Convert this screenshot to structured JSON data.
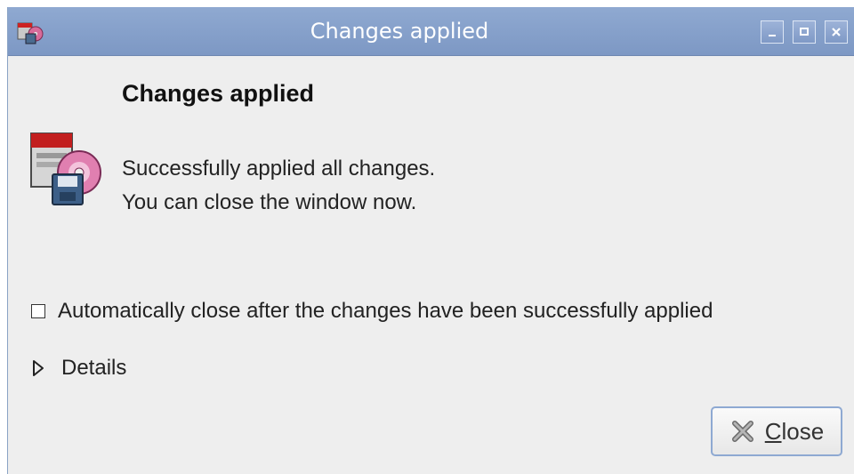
{
  "window": {
    "title": "Changes applied",
    "app_icon": "package-installer-icon",
    "controls": {
      "minimize": "minimize-icon",
      "maximize": "maximize-icon",
      "close": "close-icon"
    }
  },
  "dialog": {
    "heading": "Changes applied",
    "icon": "package-installer-icon",
    "message": "Successfully applied all changes. You can close the window now.",
    "auto_close": {
      "label": "Automatically close after the changes have been successfully applied",
      "checked": false
    },
    "details_label": "Details",
    "close_button": {
      "mnemonic": "C",
      "rest": "lose",
      "icon": "close-x-icon"
    }
  },
  "colors": {
    "titlebar": "#8fa9d1",
    "window_bg": "#eeeeee",
    "button_border": "#8ea9d2"
  }
}
